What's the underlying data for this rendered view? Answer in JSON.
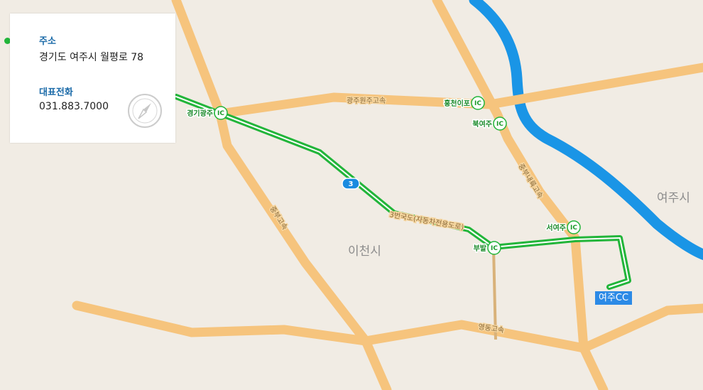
{
  "info": {
    "address_heading": "주소",
    "address_value": "경기도 여주시 월평로 78",
    "phone_heading": "대표전화",
    "phone_value": "031.883.7000"
  },
  "map": {
    "cities": [
      "이천시",
      "여주시"
    ],
    "roads": [
      "광주원주고속",
      "중부고속",
      "중부내륙고속",
      "영동고속",
      "3번국도(자동차전용도로)"
    ],
    "route_badge": "3",
    "interchanges": [
      "경기광주",
      "홍천이포",
      "북여주",
      "서여주",
      "부발"
    ],
    "ic_badge": "IC",
    "destination": "여주CC",
    "colors": {
      "background": "#f1ece4",
      "road": "#f6c47d",
      "route": "#22b53a",
      "river": "#1a95e6",
      "marker": "#2c8ae6"
    }
  },
  "icons": {
    "compass": "compass-icon"
  }
}
